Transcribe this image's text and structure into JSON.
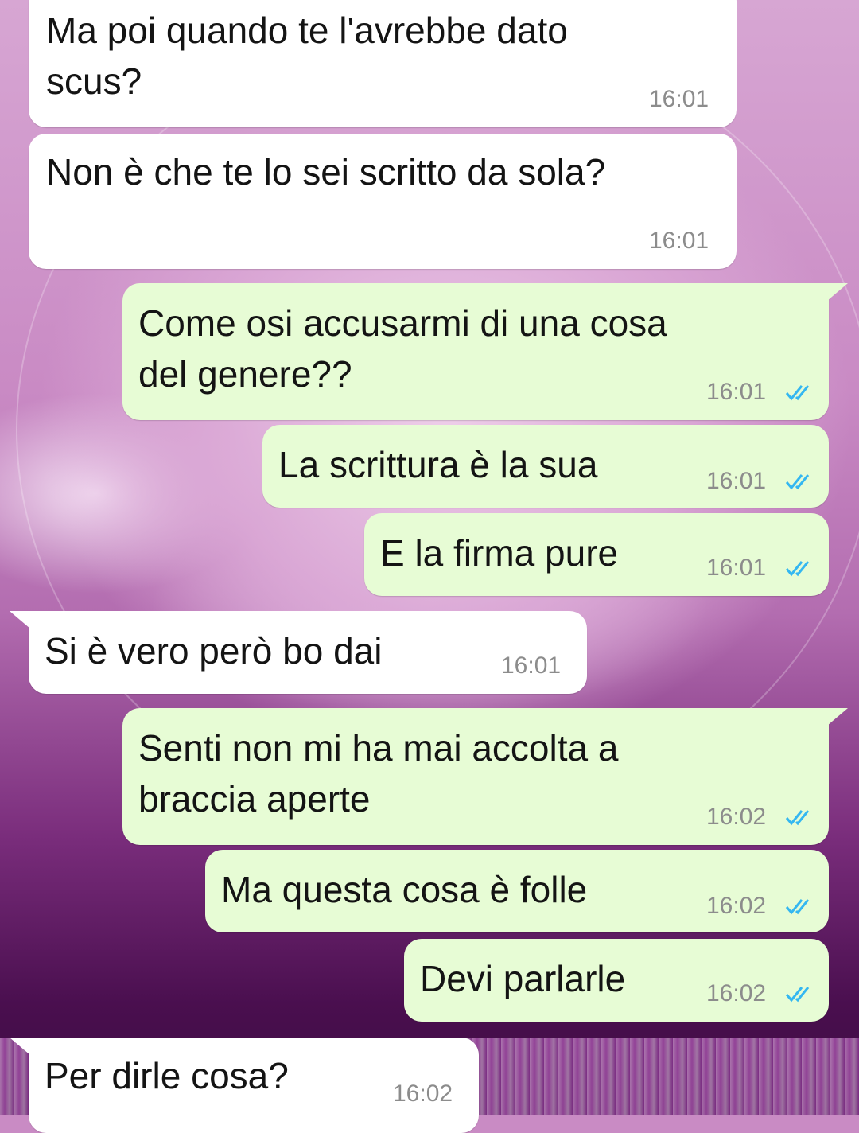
{
  "messages": [
    {
      "direction": "incoming",
      "text": "Ma poi quando te l'avrebbe dato\nscus?",
      "time": "16:01"
    },
    {
      "direction": "incoming",
      "text": "Non è che te lo sei scritto da sola?",
      "time": "16:01"
    },
    {
      "direction": "outgoing",
      "text": "Come osi accusarmi di una cosa\ndel genere??",
      "time": "16:01",
      "status": "read"
    },
    {
      "direction": "outgoing",
      "text": "La scrittura è la sua",
      "time": "16:01",
      "status": "read"
    },
    {
      "direction": "outgoing",
      "text": "E la firma pure",
      "time": "16:01",
      "status": "read"
    },
    {
      "direction": "incoming",
      "text": "Si è vero però bo dai",
      "time": "16:01"
    },
    {
      "direction": "outgoing",
      "text": "Senti non mi ha mai accolta a\nbraccia aperte",
      "time": "16:02",
      "status": "read"
    },
    {
      "direction": "outgoing",
      "text": "Ma questa cosa è folle",
      "time": "16:02",
      "status": "read"
    },
    {
      "direction": "outgoing",
      "text": "Devi parlarle",
      "time": "16:02",
      "status": "read"
    },
    {
      "direction": "incoming",
      "text": "Per dirle cosa?",
      "time": "16:02"
    }
  ],
  "colors": {
    "incoming_bubble": "#ffffff",
    "outgoing_bubble": "#e7fcd5",
    "read_ticks": "#34b7f1",
    "time_text": "#8c8c8c"
  },
  "icons": {
    "read_status": "double-check-icon"
  }
}
